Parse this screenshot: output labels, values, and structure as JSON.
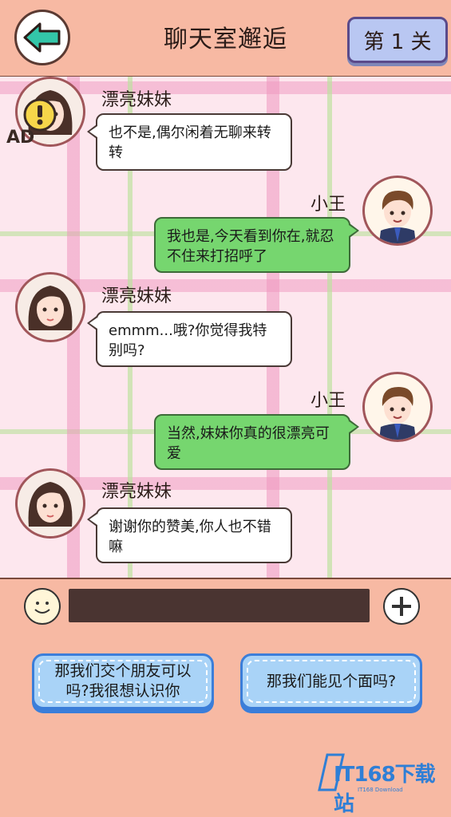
{
  "header": {
    "title": "聊天室邂逅",
    "level_label": "第 1 关"
  },
  "ad_badge": "AD",
  "messages": [
    {
      "sender": "漂亮妹妹",
      "side": "left",
      "text": "也不是,偶尔闲着无聊来转转"
    },
    {
      "sender": "小王",
      "side": "right",
      "text": "我也是,今天看到你在,就忍不住来打招呼了"
    },
    {
      "sender": "漂亮妹妹",
      "side": "left",
      "text": "emmm...哦?你觉得我特别吗?"
    },
    {
      "sender": "小王",
      "side": "right",
      "text": "当然,妹妹你真的很漂亮可爱"
    },
    {
      "sender": "漂亮妹妹",
      "side": "left",
      "text": "谢谢你的赞美,你人也不错嘛"
    }
  ],
  "options": [
    {
      "text": "那我们交个朋友可以吗?我很想认识你"
    },
    {
      "text": "那我们能见个面吗?"
    }
  ],
  "watermark": {
    "text": "IT168下载站",
    "sub": "IT168 Download"
  },
  "colors": {
    "background": "#f7b9a3",
    "left_bubble": "#ffffff",
    "right_bubble": "#76d66f",
    "option_bg": "#a9d3f7",
    "level_button": "#b9c7f2"
  }
}
